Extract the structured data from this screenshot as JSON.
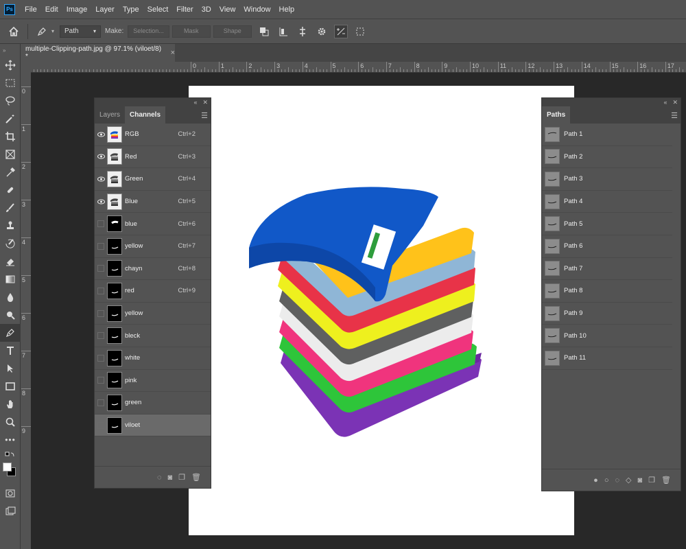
{
  "app": {
    "logo": "Ps"
  },
  "menu": [
    "File",
    "Edit",
    "Image",
    "Layer",
    "Type",
    "Select",
    "Filter",
    "3D",
    "View",
    "Window",
    "Help"
  ],
  "options_bar": {
    "tool_mode": "Path",
    "make_label": "Make:",
    "selection_btn": "Selection...",
    "mask_btn": "Mask",
    "shape_btn": "Shape"
  },
  "document": {
    "tab_title": "multiple-Clipping-path.jpg @ 97.1% (viloet/8) *",
    "close": "×"
  },
  "ruler": {
    "top": [
      "0",
      "1",
      "2",
      "3",
      "4",
      "5",
      "6",
      "7",
      "8",
      "9",
      "10",
      "11",
      "12",
      "13",
      "14",
      "15",
      "16",
      "17"
    ],
    "left": [
      "0",
      "1",
      "2",
      "3",
      "4",
      "5",
      "6",
      "7",
      "8",
      "9"
    ]
  },
  "channels_panel": {
    "tabs": [
      "Layers",
      "Channels"
    ],
    "active_tab": "Channels",
    "channels": [
      {
        "name": "RGB",
        "shortcut": "Ctrl+2",
        "visible": true,
        "thumb": "white"
      },
      {
        "name": "Red",
        "shortcut": "Ctrl+3",
        "visible": true,
        "thumb": "white"
      },
      {
        "name": "Green",
        "shortcut": "Ctrl+4",
        "visible": true,
        "thumb": "white"
      },
      {
        "name": "Blue",
        "shortcut": "Ctrl+5",
        "visible": true,
        "thumb": "white"
      },
      {
        "name": "blue",
        "shortcut": "Ctrl+6",
        "visible": false,
        "thumb": "black"
      },
      {
        "name": "yellow",
        "shortcut": "Ctrl+7",
        "visible": false,
        "thumb": "black"
      },
      {
        "name": "chayn",
        "shortcut": "Ctrl+8",
        "visible": false,
        "thumb": "black"
      },
      {
        "name": "red",
        "shortcut": "Ctrl+9",
        "visible": false,
        "thumb": "black"
      },
      {
        "name": "yellow",
        "shortcut": "",
        "visible": false,
        "thumb": "black"
      },
      {
        "name": "bleck",
        "shortcut": "",
        "visible": false,
        "thumb": "black"
      },
      {
        "name": "white",
        "shortcut": "",
        "visible": false,
        "thumb": "black"
      },
      {
        "name": "pink",
        "shortcut": "",
        "visible": false,
        "thumb": "black"
      },
      {
        "name": "green",
        "shortcut": "",
        "visible": false,
        "thumb": "black"
      },
      {
        "name": "viloet",
        "shortcut": "",
        "visible": false,
        "thumb": "black",
        "selected": true
      }
    ]
  },
  "paths_panel": {
    "title": "Paths",
    "paths": [
      "Path 1",
      "Path 2",
      "Path 3",
      "Path 4",
      "Path 5",
      "Path 6",
      "Path 7",
      "Path 8",
      "Path 9",
      "Path 10",
      "Path 11"
    ]
  },
  "colors": {
    "ui_bg": "#535353",
    "canvas_bg": "#282828",
    "accent": "#31a8ff"
  }
}
